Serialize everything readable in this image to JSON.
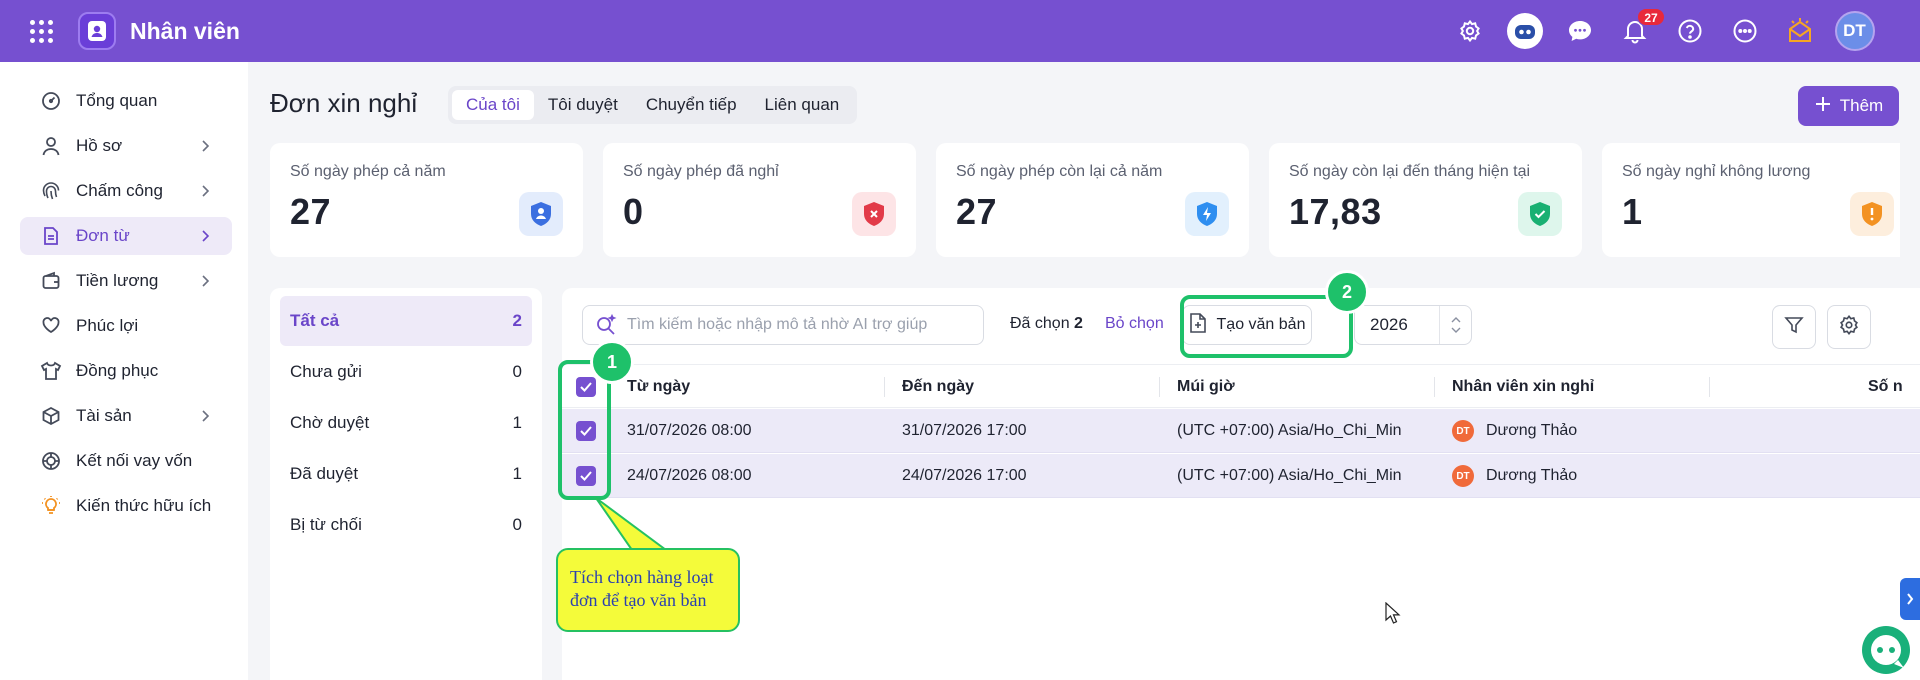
{
  "app": {
    "title": "Nhân viên"
  },
  "topbar": {
    "notification_count": "27",
    "user_initials": "DT",
    "icons": [
      "settings-icon",
      "ai-robot-icon",
      "chat-icon",
      "bell-icon",
      "help-icon",
      "more-icon",
      "announcement-icon"
    ]
  },
  "sidebar": {
    "items": [
      {
        "label": "Tổng quan",
        "icon": "dashboard-icon",
        "has_submenu": false
      },
      {
        "label": "Hồ sơ",
        "icon": "user-icon",
        "has_submenu": true
      },
      {
        "label": "Chấm công",
        "icon": "fingerprint-icon",
        "has_submenu": true
      },
      {
        "label": "Đơn từ",
        "icon": "document-icon",
        "has_submenu": true,
        "active": true
      },
      {
        "label": "Tiền lương",
        "icon": "wallet-icon",
        "has_submenu": true
      },
      {
        "label": "Phúc lợi",
        "icon": "heart-hand-icon",
        "has_submenu": false
      },
      {
        "label": "Đồng phục",
        "icon": "shirt-icon",
        "has_submenu": false
      },
      {
        "label": "Tài sản",
        "icon": "box-icon",
        "has_submenu": true
      },
      {
        "label": "Kết nối vay vốn",
        "icon": "loan-icon",
        "has_submenu": false
      },
      {
        "label": "Kiến thức hữu ích",
        "icon": "lightbulb-icon",
        "has_submenu": false
      }
    ]
  },
  "header": {
    "title": "Đơn xin nghỉ",
    "tabs": [
      "Của tôi",
      "Tôi duyệt",
      "Chuyển tiếp",
      "Liên quan"
    ],
    "active_tab": "Của tôi",
    "add_label": "Thêm"
  },
  "stats": [
    {
      "label": "Số ngày phép cả năm",
      "value": "27",
      "icon": "user-shield-icon",
      "color": "#3b6fe0"
    },
    {
      "label": "Số ngày phép đã nghỉ",
      "value": "0",
      "icon": "x-shield-icon",
      "color": "#e23a48"
    },
    {
      "label": "Số ngày phép còn lại cả năm",
      "value": "27",
      "icon": "bolt-shield-icon",
      "color": "#2e8ef0"
    },
    {
      "label": "Số ngày còn lại đến tháng hiện tại",
      "value": "17,83",
      "icon": "check-shield-icon",
      "color": "#19b072"
    },
    {
      "label": "Số ngày nghỉ không lương",
      "value": "1",
      "icon": "warning-shield-icon",
      "color": "#f39222"
    }
  ],
  "filters": [
    {
      "label": "Tất cả",
      "count": "2",
      "active": true
    },
    {
      "label": "Chưa gửi",
      "count": "0"
    },
    {
      "label": "Chờ duyệt",
      "count": "1"
    },
    {
      "label": "Đã duyệt",
      "count": "1"
    },
    {
      "label": "Bị từ chối",
      "count": "0"
    }
  ],
  "toolbar": {
    "search_placeholder": "Tìm kiếm hoặc nhập mô tả nhờ AI trợ giúp",
    "selected_prefix": "Đã chọn",
    "selected_count": "2",
    "deselect_label": "Bỏ chọn",
    "create_doc_label": "Tạo văn bản",
    "year": "2026"
  },
  "table": {
    "columns": [
      "Từ ngày",
      "Đến ngày",
      "Múi giờ",
      "Nhân viên xin nghỉ",
      "Số n"
    ],
    "rows": [
      {
        "from": "31/07/2026 08:00",
        "to": "31/07/2026 17:00",
        "timezone": "(UTC +07:00) Asia/Ho_Chi_Min",
        "employee_initials": "DT",
        "employee": "Dương Thảo",
        "checked": true
      },
      {
        "from": "24/07/2026 08:00",
        "to": "24/07/2026 17:00",
        "timezone": "(UTC +07:00) Asia/Ho_Chi_Min",
        "employee_initials": "DT",
        "employee": "Dương Thảo",
        "checked": true
      }
    ]
  },
  "annotations": {
    "step1": "1",
    "step2": "2",
    "callout_line1": "Tích chọn hàng loạt",
    "callout_line2": "đơn để tạo văn bản"
  }
}
